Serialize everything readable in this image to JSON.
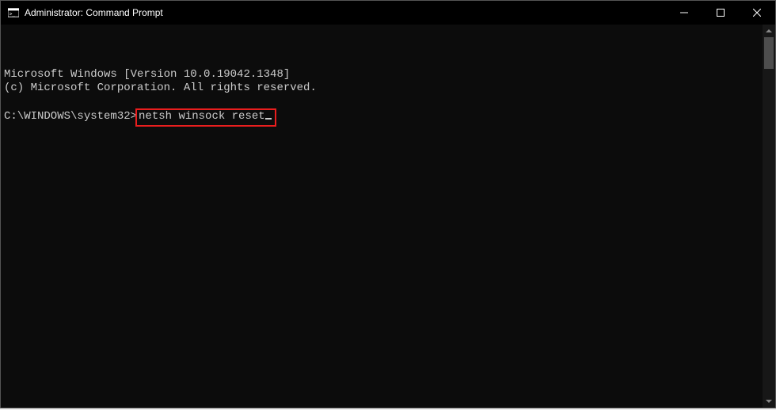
{
  "window": {
    "title": "Administrator: Command Prompt"
  },
  "terminal": {
    "line1": "Microsoft Windows [Version 10.0.19042.1348]",
    "line2": "(c) Microsoft Corporation. All rights reserved.",
    "blank": "",
    "prompt": "C:\\WINDOWS\\system32>",
    "command": "netsh winsock reset"
  },
  "highlight": {
    "color": "#e91e1e"
  }
}
